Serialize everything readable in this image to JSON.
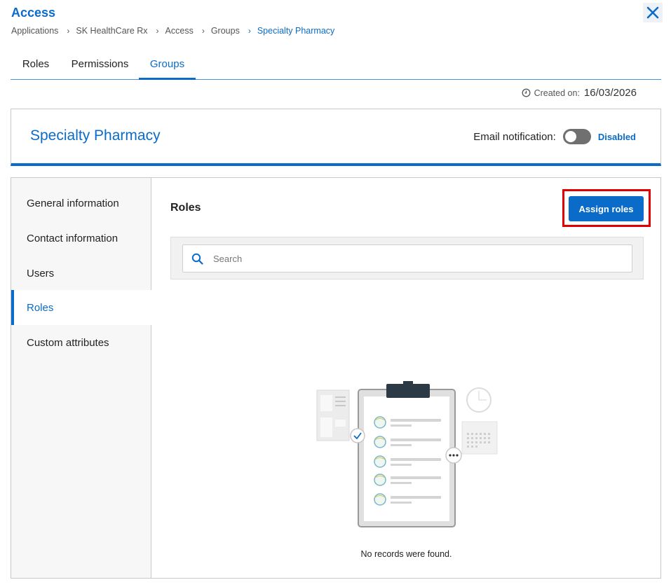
{
  "header": {
    "title": "Access",
    "close_icon": "close-icon"
  },
  "breadcrumb": [
    "Applications",
    "SK HealthCare Rx",
    "Access",
    "Groups",
    "Specialty Pharmacy"
  ],
  "tabs": [
    {
      "label": "Roles",
      "active": false
    },
    {
      "label": "Permissions",
      "active": false
    },
    {
      "label": "Groups",
      "active": true
    }
  ],
  "created": {
    "label": "Created on:",
    "date": "16/03/2026",
    "icon": "clock-icon"
  },
  "group": {
    "name": "Specialty Pharmacy",
    "email_label": "Email notification:",
    "email_enabled": false,
    "email_status": "Disabled"
  },
  "sidebar": {
    "items": [
      {
        "label": "General information",
        "active": false
      },
      {
        "label": "Contact information",
        "active": false
      },
      {
        "label": "Users",
        "active": false
      },
      {
        "label": "Roles",
        "active": true
      },
      {
        "label": "Custom attributes",
        "active": false
      }
    ]
  },
  "roles_section": {
    "title": "Roles",
    "assign_button": "Assign roles",
    "search_placeholder": "Search",
    "empty_message": "No records were found."
  },
  "colors": {
    "accent": "#0b6bc8",
    "highlight": "#e00000",
    "toggle_off": "#707070"
  }
}
